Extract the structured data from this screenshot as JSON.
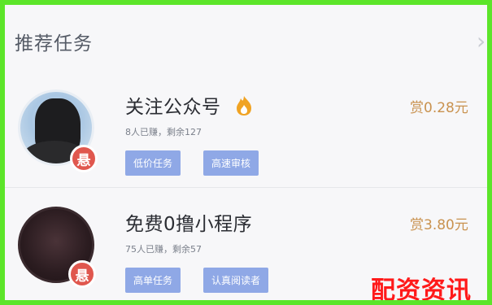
{
  "section": {
    "title": "推荐任务"
  },
  "tasks": [
    {
      "title": "关注公众号",
      "meta": "8人已赚，剩余127",
      "price": "赏0.28元",
      "tags": [
        "低价任务",
        "高速审核"
      ],
      "badge": "悬"
    },
    {
      "title": "免费0撸小程序",
      "meta": "75人已赚，剩余57",
      "price": "赏3.80元",
      "tags": [
        "高单任务",
        "认真阅读者"
      ],
      "badge": "悬"
    }
  ],
  "watermark": "配资资讯",
  "colors": {
    "frame": "#5ce52a",
    "tag": "#8fa8e6",
    "price": "#c9924f",
    "badge": "#e0574e",
    "watermark": "#ff1a1a"
  }
}
